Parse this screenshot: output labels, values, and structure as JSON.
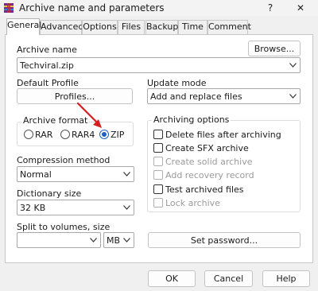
{
  "window": {
    "title": "Archive name and parameters",
    "help_glyph": "?",
    "close_glyph": "✕"
  },
  "tabs": [
    {
      "label": "General",
      "active": true
    },
    {
      "label": "Advanced"
    },
    {
      "label": "Options"
    },
    {
      "label": "Files"
    },
    {
      "label": "Backup"
    },
    {
      "label": "Time"
    },
    {
      "label": "Comment"
    }
  ],
  "general": {
    "archive_name_label": "Archive name",
    "archive_name_value": "Techviral.zip",
    "browse_label": "Browse...",
    "default_profile_label": "Default Profile",
    "profiles_label": "Profiles...",
    "update_mode_label": "Update mode",
    "update_mode_value": "Add and replace files",
    "archive_format": {
      "title": "Archive format",
      "options": [
        "RAR",
        "RAR4",
        "ZIP"
      ],
      "selected": "ZIP"
    },
    "archiving_options": {
      "title": "Archiving options",
      "items": [
        {
          "label": "Delete files after archiving",
          "enabled": true
        },
        {
          "label": "Create SFX archive",
          "enabled": true
        },
        {
          "label": "Create solid archive",
          "enabled": false
        },
        {
          "label": "Add recovery record",
          "enabled": false
        },
        {
          "label": "Test archived files",
          "enabled": true
        },
        {
          "label": "Lock archive",
          "enabled": false
        }
      ]
    },
    "compression_method_label": "Compression method",
    "compression_method_value": "Normal",
    "dictionary_size_label": "Dictionary size",
    "dictionary_size_value": "32 KB",
    "split_label": "Split to volumes, size",
    "split_value": "",
    "split_unit": "MB",
    "set_password_label": "Set password..."
  },
  "footer": {
    "ok_label": "OK",
    "cancel_label": "Cancel",
    "help_label": "Help"
  },
  "colors": {
    "accent": "#1f5fbf",
    "annotation_arrow": "#d42020"
  }
}
